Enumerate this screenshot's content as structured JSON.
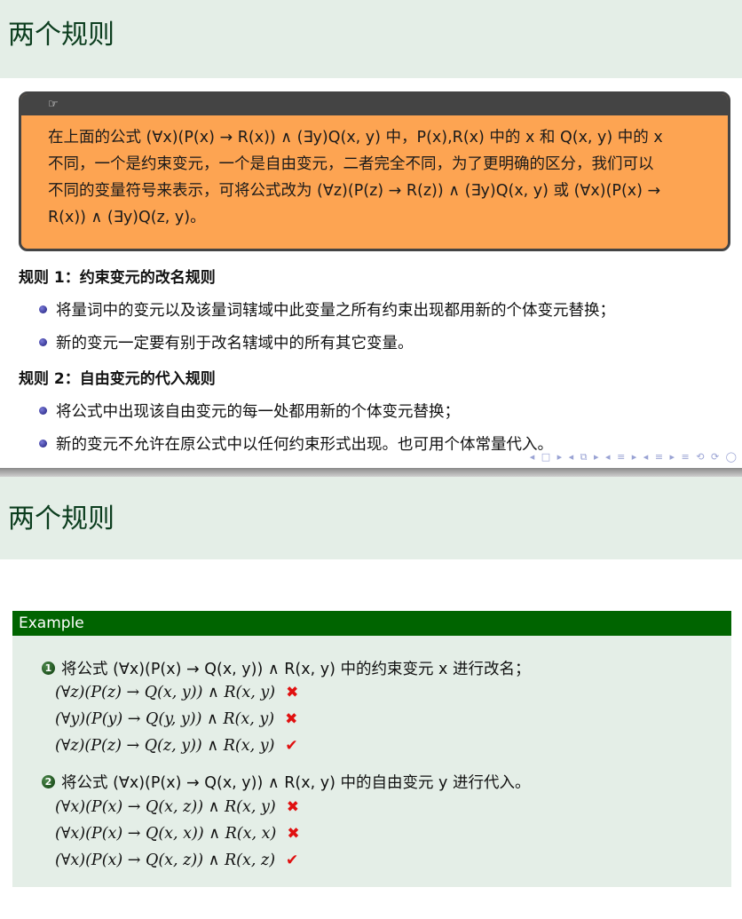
{
  "slide1": {
    "title": "两个规则",
    "note_icon": "☞",
    "note_lines": [
      "在上面的公式 (∀x)(P(x) → R(x)) ∧ (∃y)Q(x, y) 中，P(x),R(x) 中的 x 和 Q(x, y) 中的 x",
      "不同，一个是约束变元，一个是自由变元，二者完全不同，为了更明确的区分，我们可以",
      "不同的变量符号来表示，可将公式改为 (∀z)(P(z) → R(z)) ∧ (∃y)Q(x, y) 或 (∀x)(P(x) →",
      "R(x)) ∧ (∃y)Q(z, y)。"
    ],
    "rule1_title": "规则 1：约束变元的改名规则",
    "rule1_items": [
      "将量词中的变元以及该量词辖域中此变量之所有约束出现都用新的个体变元替换；",
      "新的变元一定要有别于改名辖域中的所有其它变量。"
    ],
    "rule2_title": "规则 2：自由变元的代入规则",
    "rule2_items": [
      "将公式中出现该自由变元的每一处都用新的个体变元替换；",
      "新的变元不允许在原公式中以任何约束形式出现。也可用个体常量代入。"
    ],
    "nav": "◂ □ ▸ ◂ ⧉ ▸ ◂ ≡ ▸ ◂ ≡ ▸   ≡   ⟲ ⟳ ◯"
  },
  "slide2": {
    "title": "两个规则",
    "example_label": "Example",
    "items": [
      {
        "num": "1",
        "text": "将公式 (∀x)(P(x) → Q(x, y)) ∧ R(x, y) 中的约束变元 x 进行改名；",
        "cases": [
          {
            "formula": "(∀z)(P(z) → Q(x, y)) ∧ R(x, y)",
            "mark": "✖"
          },
          {
            "formula": "(∀y)(P(y) → Q(y, y)) ∧ R(x, y)",
            "mark": "✖"
          },
          {
            "formula": "(∀z)(P(z) → Q(z, y)) ∧ R(x, y)",
            "mark": "✔"
          }
        ]
      },
      {
        "num": "2",
        "text": "将公式 (∀x)(P(x) → Q(x, y)) ∧ R(x, y) 中的自由变元 y 进行代入。",
        "cases": [
          {
            "formula": "(∀x)(P(x) → Q(x, z)) ∧ R(x, y)",
            "mark": "✖"
          },
          {
            "formula": "(∀x)(P(x) → Q(x, x)) ∧ R(x, x)",
            "mark": "✖"
          },
          {
            "formula": "(∀x)(P(x) → Q(x, z)) ∧ R(x, z)",
            "mark": "✔"
          }
        ]
      }
    ]
  },
  "colors": {
    "title_bar": "#e4eee7",
    "title_text": "#0b3d1e",
    "note_bg": "#fda452",
    "example_head": "#006400",
    "mark_red": "#e01010"
  }
}
